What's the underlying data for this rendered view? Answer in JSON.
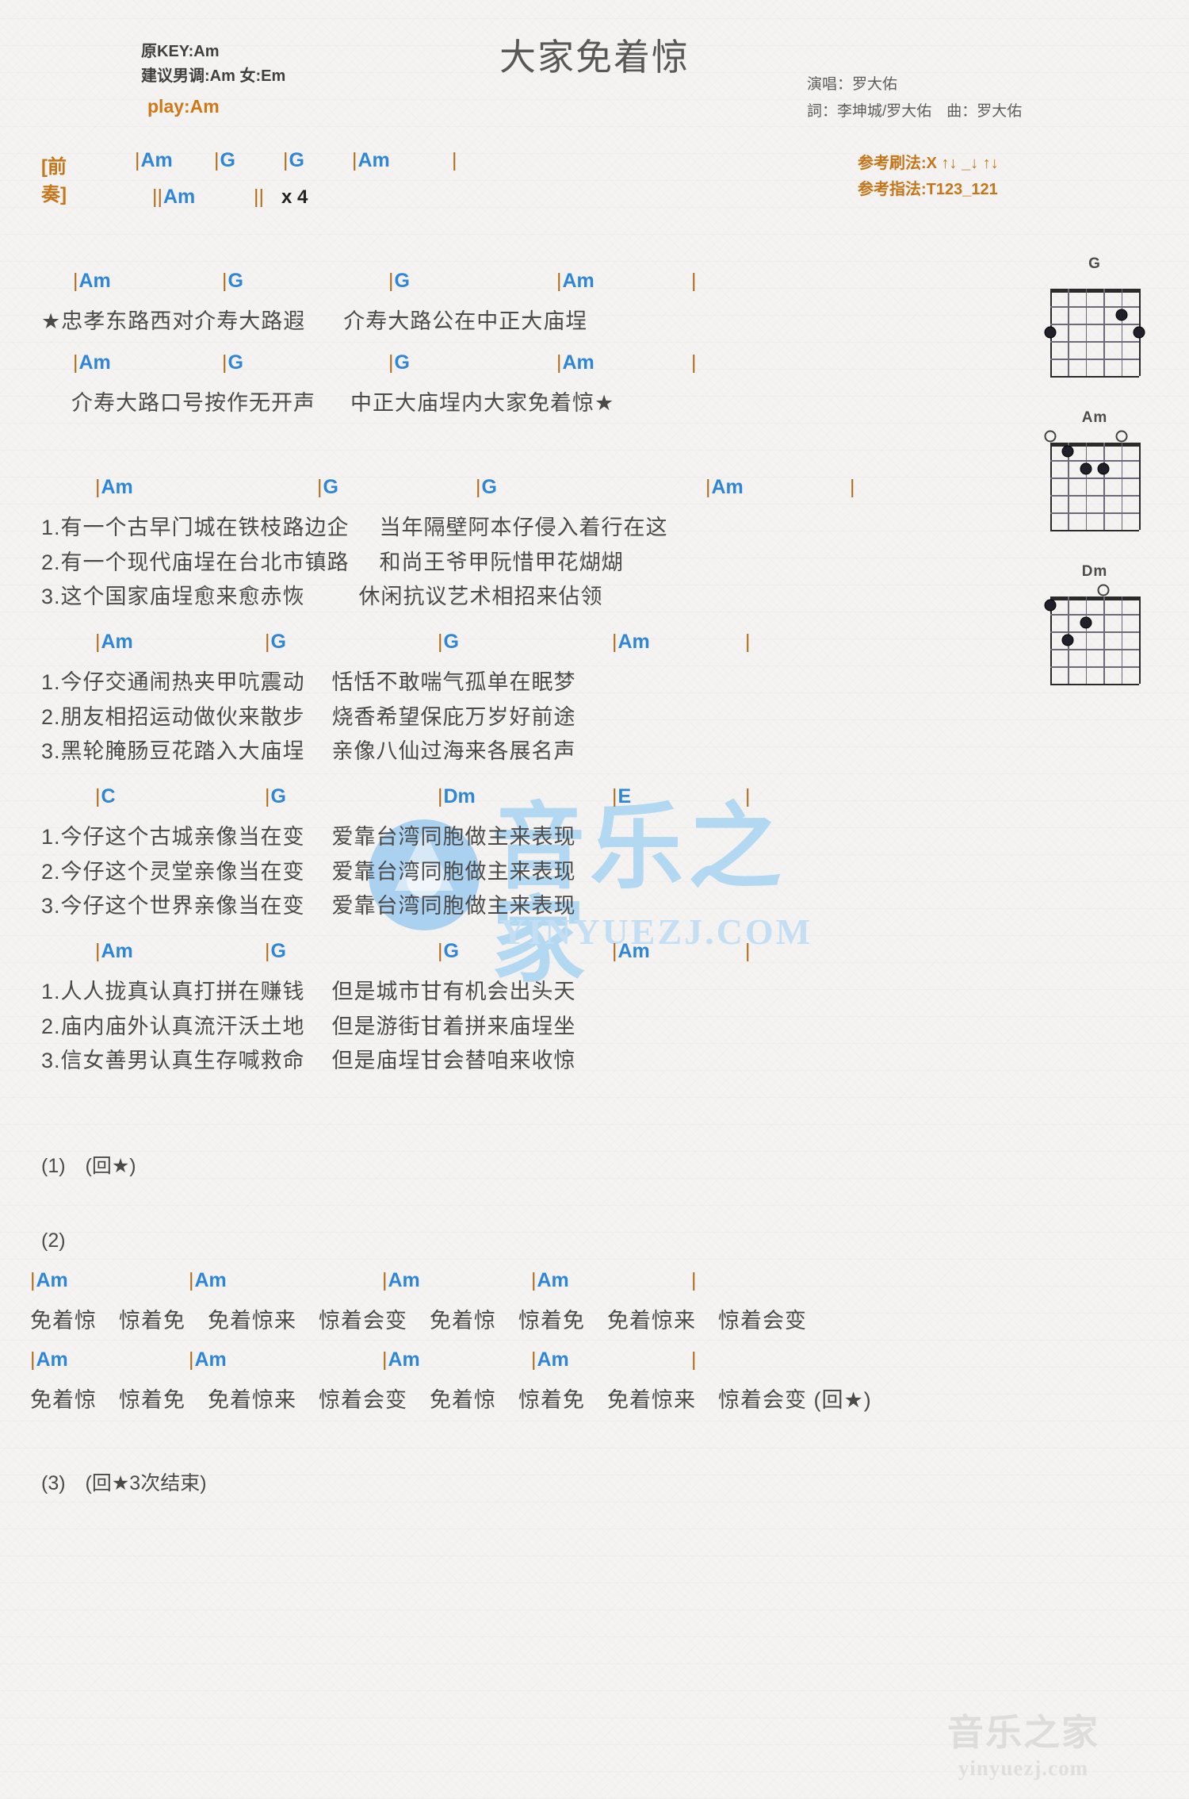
{
  "header": {
    "orig_key": "原KEY:Am",
    "suggest_key": "建议男调:Am 女:Em",
    "play_key": "play:Am",
    "title": "大家免着惊",
    "singer": "演唱：罗大佑",
    "writer": "詞：李坤城/罗大佑　曲：罗大佑",
    "ref_strum": "参考刷法:X ↑↓ _↓ ↑↓",
    "ref_finger": "参考指法:T123_121"
  },
  "intro": {
    "tag": "[前奏]",
    "row1": [
      "Am",
      "G",
      "G",
      "Am"
    ],
    "row1_end_bar": "|",
    "row2_chord": "Am",
    "row2_end": "||",
    "row2_times": "x 4"
  },
  "star_section": [
    {
      "chords": [
        "Am",
        "G",
        "G",
        "Am"
      ],
      "end_bar": "|",
      "lyric_a": "★忠孝东路西对介寿大路遐",
      "lyric_b": "介寿大路公在中正大庙埕"
    },
    {
      "chords": [
        "Am",
        "G",
        "G",
        "Am"
      ],
      "end_bar": "|",
      "lyric_a": "介寿大路口号按作无开声",
      "lyric_b": "中正大庙埕内大家免着惊★"
    }
  ],
  "verses": [
    {
      "chords": [
        "Am",
        "G",
        "G",
        "Am"
      ],
      "end_bar": "|",
      "lines": [
        {
          "num": "1.",
          "a": "有一个古早门城在铁枝路边企",
          "b": "当年隔壁阿本仔侵入着行在这"
        },
        {
          "num": "2.",
          "a": "有一个现代庙埕在台北市镇路",
          "b": "和尚王爷甲阮惜甲花煳煳"
        },
        {
          "num": "3.",
          "a": "这个国家庙埕愈来愈赤恢",
          "b": "休闲抗议艺术相招来佔领"
        }
      ]
    },
    {
      "chords": [
        "Am",
        "G",
        "G",
        "Am"
      ],
      "end_bar": "|",
      "lines": [
        {
          "num": "1.",
          "a": "今仔交通闹热夹甲吭震动",
          "b": "恬恬不敢喘气孤单在眠梦"
        },
        {
          "num": "2.",
          "a": "朋友相招运动做伙来散步",
          "b": "烧香希望保庇万岁好前途"
        },
        {
          "num": "3.",
          "a": "黑轮腌肠豆花踏入大庙埕",
          "b": "亲像八仙过海来各展名声"
        }
      ]
    },
    {
      "chords": [
        "C",
        "G",
        "Dm",
        "E"
      ],
      "end_bar": "|",
      "lines": [
        {
          "num": "1.",
          "a": "今仔这个古城亲像当在变",
          "b": "爱靠台湾同胞做主来表现"
        },
        {
          "num": "2.",
          "a": "今仔这个灵堂亲像当在变",
          "b": "爱靠台湾同胞做主来表现"
        },
        {
          "num": "3.",
          "a": "今仔这个世界亲像当在变",
          "b": "爱靠台湾同胞做主来表现"
        }
      ]
    },
    {
      "chords": [
        "Am",
        "G",
        "G",
        "Am"
      ],
      "end_bar": "|",
      "lines": [
        {
          "num": "1.",
          "a": "人人拢真认真打拼在赚钱",
          "b": "但是城市甘有机会出头天"
        },
        {
          "num": "2.",
          "a": "庙内庙外认真流汗沃土地",
          "b": "但是游街甘着拼来庙埕坐"
        },
        {
          "num": "3.",
          "a": "信女善男认真生存喊救命",
          "b": "但是庙埕甘会替咱来收惊"
        }
      ]
    }
  ],
  "markers": {
    "m1": "(1)　(回★)",
    "m2": "(2)",
    "m3": "(3)　(回★3次结束)"
  },
  "outro": {
    "rows": [
      {
        "chords": [
          "Am",
          "Am",
          "Am",
          "Am"
        ],
        "end_bar": "|",
        "lyric": "免着惊　惊着免　免着惊来　惊着会变　免着惊　惊着免　免着惊来　惊着会变"
      },
      {
        "chords": [
          "Am",
          "Am",
          "Am",
          "Am"
        ],
        "end_bar": "|",
        "lyric": "免着惊　惊着免　免着惊来　惊着会变　免着惊　惊着免　免着惊来　惊着会变 (回★)"
      }
    ]
  },
  "chord_diagrams": [
    {
      "name": "G",
      "open_strings": [],
      "dots": [
        {
          "string": 5,
          "fret": 2
        },
        {
          "string": 6,
          "fret": 3
        },
        {
          "string": 1,
          "fret": 3
        }
      ]
    },
    {
      "name": "Am",
      "open_strings": [
        5,
        1
      ],
      "dots": [
        {
          "string": 2,
          "fret": 1
        },
        {
          "string": 4,
          "fret": 2
        },
        {
          "string": 3,
          "fret": 2
        }
      ]
    },
    {
      "name": "Dm",
      "open_strings": [
        4
      ],
      "dots": [
        {
          "string": 1,
          "fret": 1
        },
        {
          "string": 3,
          "fret": 2
        },
        {
          "string": 2,
          "fret": 3
        }
      ]
    }
  ],
  "watermark": {
    "center_text": "音乐之家",
    "center_sub": "YINYUEZJ.COM",
    "bottom_text": "音乐之家",
    "bottom_sub": "yinyuezj.com"
  },
  "colors": {
    "chord": "#2f86d6",
    "bar": "#b06b18",
    "accent": "#c6761a",
    "lyric": "#4a4a4a",
    "title": "#585858",
    "bg": "#f4f3f1"
  }
}
